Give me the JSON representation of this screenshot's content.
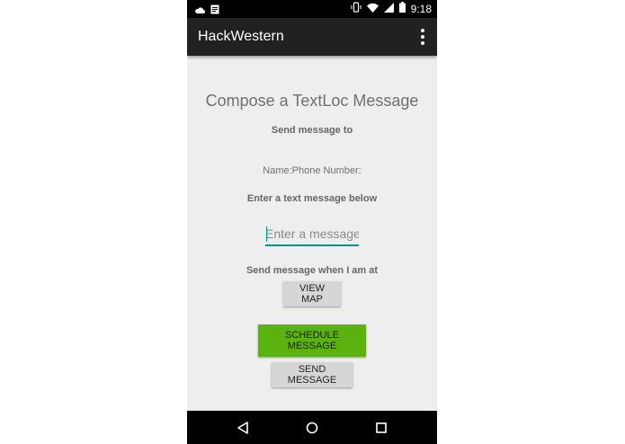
{
  "status_bar": {
    "time": "9:18",
    "left_icons": [
      "cloud-icon",
      "notification-icon"
    ],
    "right_icons": [
      "vibrate-icon",
      "wifi-icon",
      "signal-icon",
      "battery-icon"
    ]
  },
  "app_bar": {
    "title": "HackWestern",
    "menu_icon": "overflow-menu-icon"
  },
  "main": {
    "heading": "Compose a TextLoc Message",
    "send_to_label": "Send message to",
    "contact_info": "Name:Phone Number:",
    "message_prompt": "Enter a text message below",
    "message_input": {
      "value": "",
      "placeholder": "Enter a message"
    },
    "location_label": "Send message when I am at",
    "view_map_label": "VIEW MAP",
    "schedule_label": "SCHEDULE MESSAGE",
    "send_label": "SEND MESSAGE"
  },
  "nav_bar": {
    "buttons": [
      "back-icon",
      "home-icon",
      "recents-icon"
    ]
  },
  "colors": {
    "accent": "#009688",
    "schedule_button": "#5cb310",
    "app_bar": "#212121",
    "background": "#eeeeee"
  }
}
